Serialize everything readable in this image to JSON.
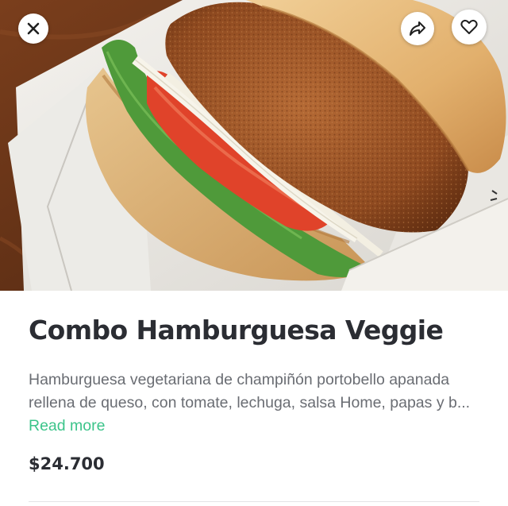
{
  "product": {
    "title": "Combo Hamburguesa Veggie",
    "description": "Hamburguesa vegetariana de champiñón portobello apanada rellena de queso, con tomate, lechuga, salsa Home, papas y b...",
    "read_more_label": "Read more",
    "price": "$24.700"
  },
  "header_actions": {
    "close_icon": "close-icon",
    "share_icon": "share-arrow-icon",
    "favorite_icon": "heart-outline-icon"
  },
  "colors": {
    "title_text": "#2b2d33",
    "description_text": "#6a6d73",
    "link_accent": "#3cc48a"
  }
}
